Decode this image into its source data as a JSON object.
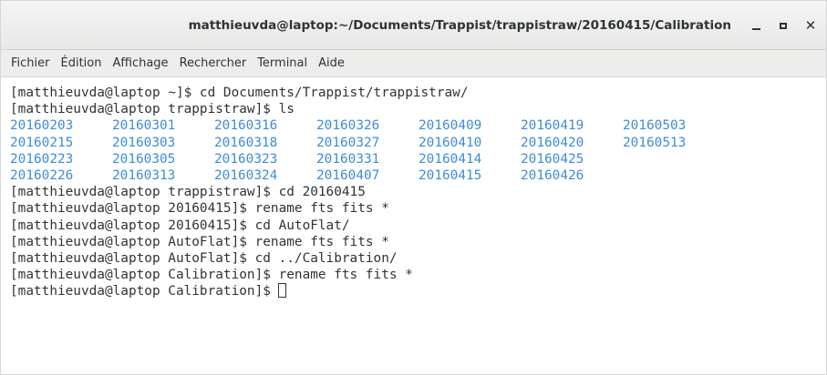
{
  "window": {
    "title": "matthieuvda@laptop:~/Documents/Trappist/trappistraw/20160415/Calibration"
  },
  "menu": [
    "Fichier",
    "Édition",
    "Affichage",
    "Rechercher",
    "Terminal",
    "Aide"
  ],
  "terminal": {
    "lines_before": [
      "[matthieuvda@laptop ~]$ cd Documents/Trappist/trappistraw/",
      "[matthieuvda@laptop trappistraw]$ ls"
    ],
    "ls_rows": [
      [
        "20160203",
        "20160301",
        "20160316",
        "20160326",
        "20160409",
        "20160419",
        "20160503"
      ],
      [
        "20160215",
        "20160303",
        "20160318",
        "20160327",
        "20160410",
        "20160420",
        "20160513"
      ],
      [
        "20160223",
        "20160305",
        "20160323",
        "20160331",
        "20160414",
        "20160425"
      ],
      [
        "20160226",
        "20160313",
        "20160324",
        "20160407",
        "20160415",
        "20160426"
      ]
    ],
    "lines_after": [
      "[matthieuvda@laptop trappistraw]$ cd 20160415",
      "[matthieuvda@laptop 20160415]$ rename fts fits *",
      "[matthieuvda@laptop 20160415]$ cd AutoFlat/",
      "[matthieuvda@laptop AutoFlat]$ rename fts fits *",
      "[matthieuvda@laptop AutoFlat]$ cd ../Calibration/",
      "[matthieuvda@laptop Calibration]$ rename fts fits *"
    ],
    "prompt": "[matthieuvda@laptop Calibration]$"
  },
  "colors": {
    "directory": "#3f8bd6",
    "text": "#2e3436",
    "background": "#ffffff"
  },
  "icons": {
    "minimize": "minimize-icon",
    "maximize": "maximize-icon",
    "close": "close-icon"
  }
}
